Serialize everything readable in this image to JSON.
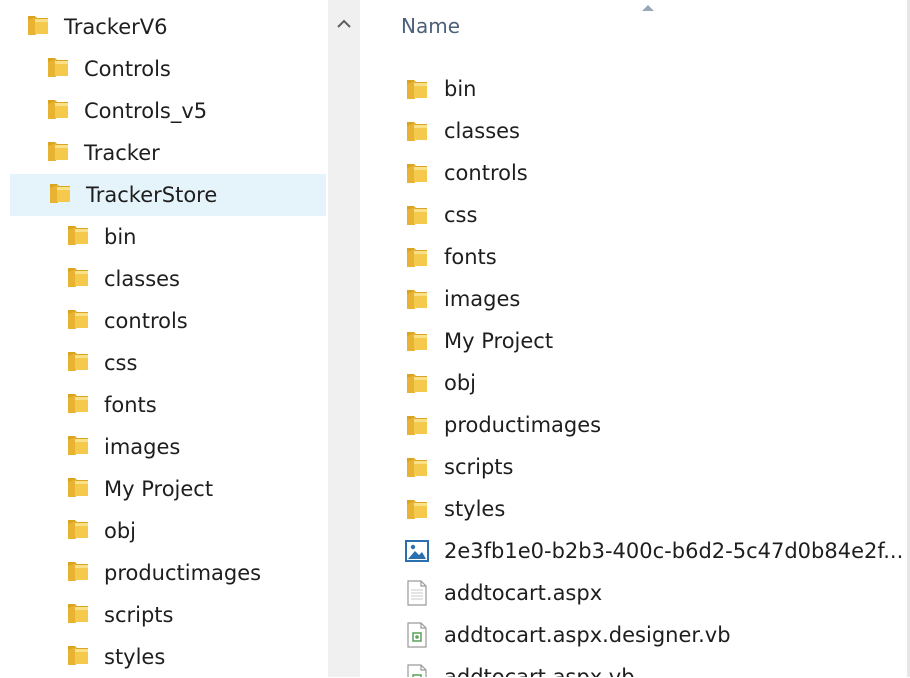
{
  "tree": {
    "root": "TrackerV6",
    "items": [
      {
        "label": "Controls",
        "depth": 1
      },
      {
        "label": "Controls_v5",
        "depth": 1
      },
      {
        "label": "Tracker",
        "depth": 1
      },
      {
        "label": "TrackerStore",
        "depth": 1,
        "selected": true
      },
      {
        "label": "bin",
        "depth": 2
      },
      {
        "label": "classes",
        "depth": 2
      },
      {
        "label": "controls",
        "depth": 2
      },
      {
        "label": "css",
        "depth": 2
      },
      {
        "label": "fonts",
        "depth": 2
      },
      {
        "label": "images",
        "depth": 2
      },
      {
        "label": "My Project",
        "depth": 2
      },
      {
        "label": "obj",
        "depth": 2
      },
      {
        "label": "productimages",
        "depth": 2
      },
      {
        "label": "scripts",
        "depth": 2
      },
      {
        "label": "styles",
        "depth": 2
      }
    ]
  },
  "content": {
    "column_header": "Name",
    "items": [
      {
        "label": "bin",
        "icon": "folder-icon"
      },
      {
        "label": "classes",
        "icon": "folder-icon"
      },
      {
        "label": "controls",
        "icon": "folder-icon"
      },
      {
        "label": "css",
        "icon": "folder-icon"
      },
      {
        "label": "fonts",
        "icon": "folder-icon"
      },
      {
        "label": "images",
        "icon": "folder-icon"
      },
      {
        "label": "My Project",
        "icon": "folder-icon"
      },
      {
        "label": "obj",
        "icon": "folder-icon"
      },
      {
        "label": "productimages",
        "icon": "folder-icon"
      },
      {
        "label": "scripts",
        "icon": "folder-icon"
      },
      {
        "label": "styles",
        "icon": "folder-icon"
      },
      {
        "label": "2e3fb1e0-b2b3-400c-b6d2-5c47d0b84e2f...",
        "icon": "image-file-icon"
      },
      {
        "label": "addtocart.aspx",
        "icon": "document-icon"
      },
      {
        "label": "addtocart.aspx.designer.vb",
        "icon": "vb-file-icon"
      },
      {
        "label": "addtocart.aspx.vb",
        "icon": "vb-file-icon"
      }
    ]
  },
  "colors": {
    "selection": "#e5f3fb",
    "scrollbar": "#f0f0f0",
    "header_text": "#4c607a",
    "folder_front": "#f5c94c",
    "folder_back": "#d9a520"
  }
}
